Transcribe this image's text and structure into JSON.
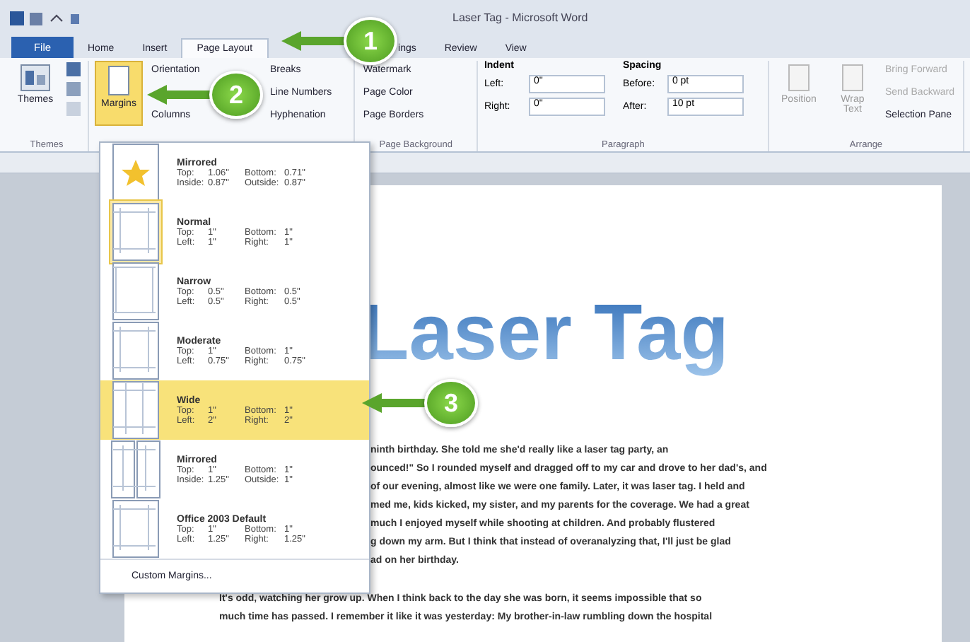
{
  "window": {
    "title": "Laser Tag - Microsoft Word"
  },
  "tabs": [
    {
      "label": "File",
      "selected": false,
      "kind": "file"
    },
    {
      "label": "Home",
      "selected": false,
      "kind": "tab"
    },
    {
      "label": "Insert",
      "selected": false,
      "kind": "tab"
    },
    {
      "label": "Page Layout",
      "selected": true,
      "kind": "tab"
    },
    {
      "label": "ings",
      "selected": false,
      "kind": "partial"
    },
    {
      "label": "Review",
      "selected": false,
      "kind": "tab"
    },
    {
      "label": "View",
      "selected": false,
      "kind": "tab"
    }
  ],
  "ribbon": {
    "themes": {
      "button": "Themes",
      "group": "Themes"
    },
    "margins": {
      "label": "Margins",
      "open": true
    },
    "page_setup": [
      "Orientation",
      "Columns"
    ],
    "page_setup_2": [
      "Breaks",
      "Line Numbers",
      "Hyphenation"
    ],
    "background": {
      "items": [
        "Watermark",
        "Page Color",
        "Page Borders"
      ],
      "group": "Page Background"
    },
    "indent": {
      "title": "Indent",
      "rows": [
        {
          "label": "Left:",
          "value": "0\""
        },
        {
          "label": "Right:",
          "value": "0\""
        }
      ]
    },
    "spacing": {
      "title": "Spacing",
      "rows": [
        {
          "label": "Before:",
          "value": "0 pt"
        },
        {
          "label": "After:",
          "value": "10 pt"
        }
      ]
    },
    "paragraph_group": "Paragraph",
    "arrange": {
      "buttons": [
        "Position",
        "Wrap Text"
      ],
      "items": [
        {
          "label": "Bring Forward",
          "disabled": true
        },
        {
          "label": "Send Backward",
          "disabled": true
        },
        {
          "label": "Selection Pane",
          "disabled": false
        }
      ],
      "group": "Arrange"
    }
  },
  "margins_menu": {
    "items": [
      {
        "name": "Mirrored",
        "kind": "star",
        "selected": false,
        "current": false,
        "values": [
          [
            "Top:",
            "1.06\"",
            "Bottom:",
            "0.71\""
          ],
          [
            "Inside:",
            "0.87\"",
            "Outside:",
            "0.87\""
          ]
        ]
      },
      {
        "name": "Normal",
        "kind": "normal",
        "selected": false,
        "current": true,
        "values": [
          [
            "Top:",
            "1\"",
            "Bottom:",
            "1\""
          ],
          [
            "Left:",
            "1\"",
            "Right:",
            "1\""
          ]
        ]
      },
      {
        "name": "Narrow",
        "kind": "narrow",
        "selected": false,
        "current": false,
        "values": [
          [
            "Top:",
            "0.5\"",
            "Bottom:",
            "0.5\""
          ],
          [
            "Left:",
            "0.5\"",
            "Right:",
            "0.5\""
          ]
        ]
      },
      {
        "name": "Moderate",
        "kind": "moderate",
        "selected": false,
        "current": false,
        "values": [
          [
            "Top:",
            "1\"",
            "Bottom:",
            "1\""
          ],
          [
            "Left:",
            "0.75\"",
            "Right:",
            "0.75\""
          ]
        ]
      },
      {
        "name": "Wide",
        "kind": "wide",
        "selected": true,
        "current": false,
        "values": [
          [
            "Top:",
            "1\"",
            "Bottom:",
            "1\""
          ],
          [
            "Left:",
            "2\"",
            "Right:",
            "2\""
          ]
        ]
      },
      {
        "name": "Mirrored",
        "kind": "mirrored",
        "selected": false,
        "current": false,
        "values": [
          [
            "Top:",
            "1\"",
            "Bottom:",
            "1\""
          ],
          [
            "Inside:",
            "1.25\"",
            "Outside:",
            "1\""
          ]
        ]
      },
      {
        "name": "Office 2003 Default",
        "kind": "normal",
        "selected": false,
        "current": false,
        "values": [
          [
            "Top:",
            "1\"",
            "Bottom:",
            "1\""
          ],
          [
            "Left:",
            "1.25\"",
            "Right:",
            "1.25\""
          ]
        ]
      }
    ],
    "footer": "Custom Margins..."
  },
  "document": {
    "title": "Laser Tag",
    "paragraph_1_lines": [
      "ninth birthday. She told me she'd really like a laser tag party, an",
      "ounced!\" So I rounded myself and dragged off to my car and drove to her dad's, and",
      "of our evening, almost like we were one family. Later, it was laser tag. I held and",
      "med me, kids kicked, my sister, and my parents for the coverage. We had a great",
      "much I enjoyed myself while shooting at children. And probably flustered",
      "g down my arm. But I think that instead of overanalyzing that, I'll just be glad",
      "ad on her birthday."
    ],
    "paragraph_2_lines": [
      "It's odd, watching her grow up. When I think back to the day she was born, it seems impossible that so",
      "much time has passed. I remember it like it was yesterday: My brother-in-law rumbling down the hospital"
    ]
  },
  "callouts": [
    {
      "number": "1"
    },
    {
      "number": "2"
    },
    {
      "number": "3"
    }
  ]
}
